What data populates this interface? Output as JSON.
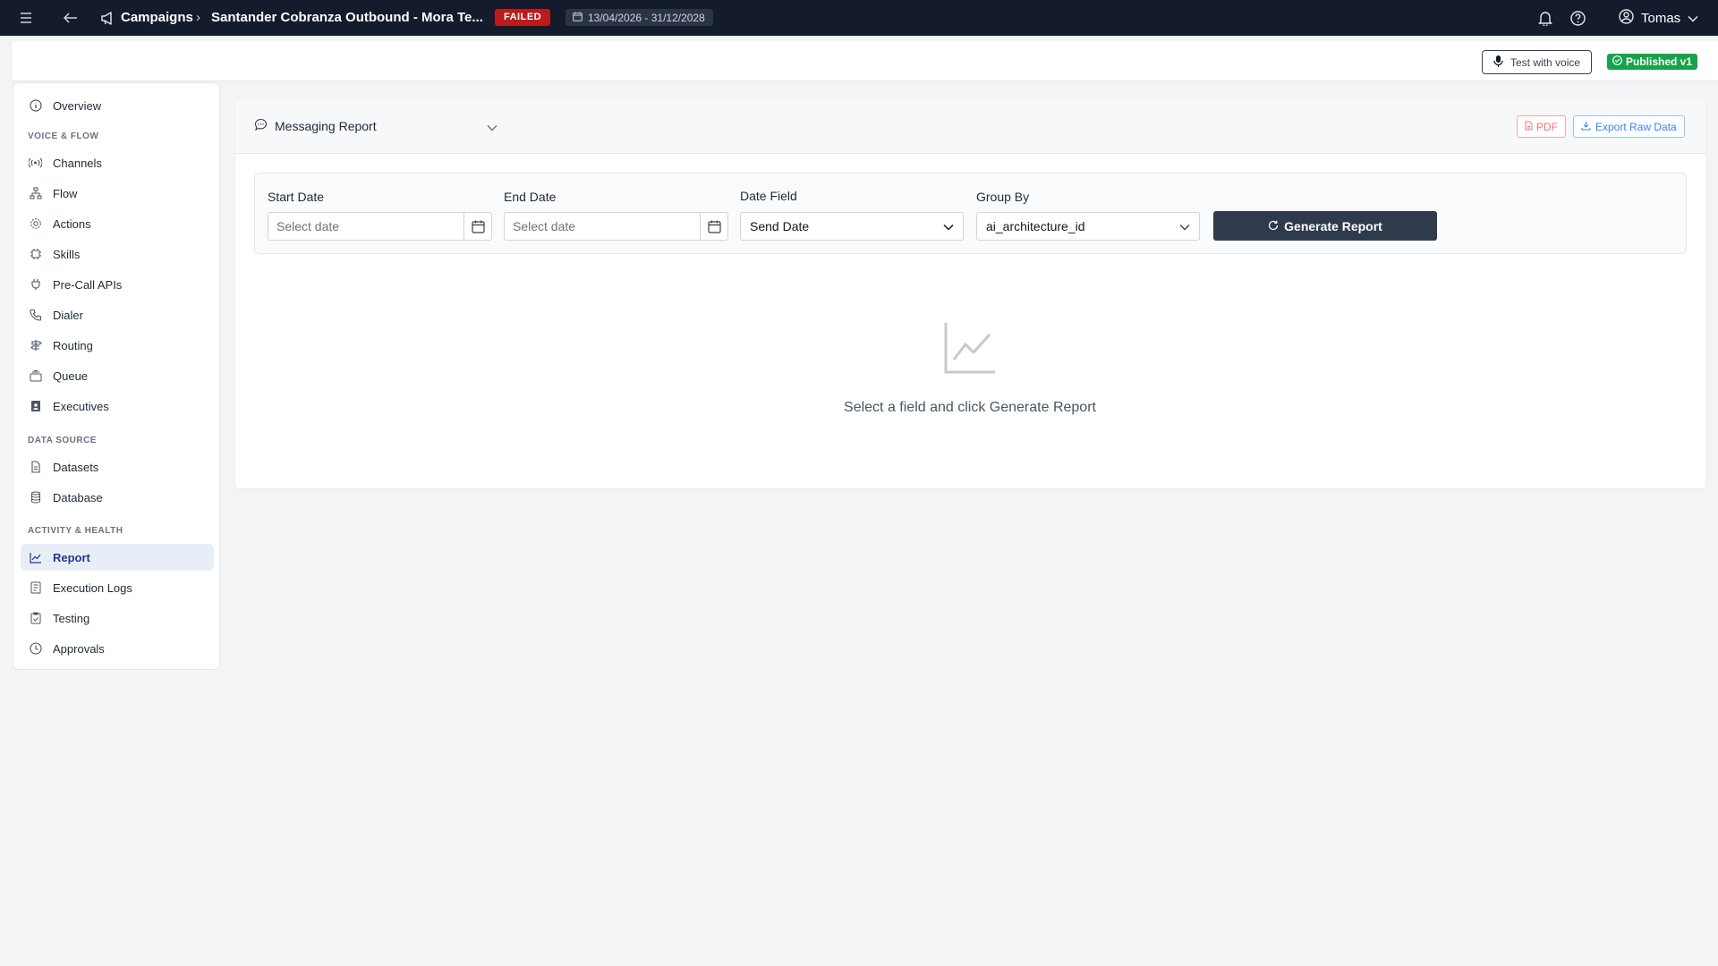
{
  "topbar": {
    "breadcrumb_parent": "Campaigns",
    "breadcrumb_sep": "›",
    "breadcrumb_current": "Santander Cobranza Outbound - Mora Te...",
    "status": "FAILED",
    "date_range": "13/04/2026 - 31/12/2028",
    "user_name": "Tomas"
  },
  "header": {
    "test_voice_label": "Test with voice",
    "published_label": "Published v1"
  },
  "sidebar": {
    "overview": "Overview",
    "section_voice": "VOICE & FLOW",
    "channels": "Channels",
    "flow": "Flow",
    "actions": "Actions",
    "skills": "Skills",
    "precall": "Pre-Call APIs",
    "dialer": "Dialer",
    "routing": "Routing",
    "queue": "Queue",
    "executives": "Executives",
    "section_data": "DATA SOURCE",
    "datasets": "Datasets",
    "database": "Database",
    "section_activity": "ACTIVITY & HEALTH",
    "report": "Report",
    "execution_logs": "Execution Logs",
    "testing": "Testing",
    "approvals": "Approvals"
  },
  "report": {
    "selected_report": "Messaging Report",
    "pdf_label": "PDF",
    "export_label": "Export Raw Data",
    "start_date_label": "Start Date",
    "start_date_placeholder": "Select date",
    "end_date_label": "End Date",
    "end_date_placeholder": "Select date",
    "date_field_label": "Date Field",
    "date_field_value": "Send Date",
    "group_by_label": "Group By",
    "group_by_value": "ai_architecture_id",
    "generate_label": "Generate Report",
    "empty_message": "Select a field and click Generate Report"
  },
  "colors": {
    "nav_bg": "#141b2d",
    "failed": "#b91c1c",
    "published": "#16a34a",
    "primary_button": "#2f3b4d",
    "active_item_bg": "#e8eef8"
  }
}
